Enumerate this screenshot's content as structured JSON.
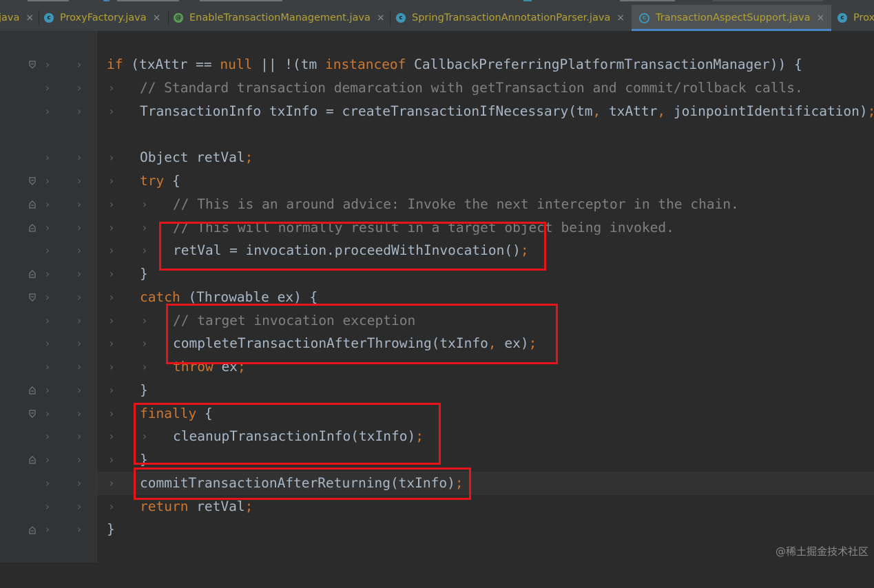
{
  "tabs": [
    {
      "label": "java",
      "icon": "none",
      "active": false
    },
    {
      "label": "ProxyFactory.java",
      "icon": "class-icon",
      "active": false
    },
    {
      "label": "EnableTransactionManagement.java",
      "icon": "annotation-icon",
      "active": false
    },
    {
      "label": "SpringTransactionAnnotationParser.java",
      "icon": "class-icon",
      "active": false
    },
    {
      "label": "TransactionAspectSupport.java",
      "icon": "abstract-class-icon",
      "active": true
    },
    {
      "label": "Prox",
      "icon": "class-icon",
      "active": false
    }
  ],
  "close_glyph": "×",
  "code_lines": [
    "if (txAttr == null || !(tm instanceof CallbackPreferringPlatformTransactionManager)) {",
    "// Standard transaction demarcation with getTransaction and commit/rollback calls.",
    "TransactionInfo txInfo = createTransactionIfNecessary(tm, txAttr, joinpointIdentification);",
    "",
    "Object retVal;",
    "try {",
    "// This is an around advice: Invoke the next interceptor in the chain.",
    "// This will normally result in a target object being invoked.",
    "retVal = invocation.proceedWithInvocation();",
    "}",
    "catch (Throwable ex) {",
    "// target invocation exception",
    "completeTransactionAfterThrowing(txInfo, ex);",
    "throw ex;",
    "}",
    "finally {",
    "cleanupTransactionInfo(txInfo);",
    "}",
    "commitTransactionAfterReturning(txInfo);",
    "return retVal;",
    "}"
  ],
  "watermark": "@稀土掘金技术社区",
  "colors": {
    "background": "#2b2b2b",
    "keyword": "#cc7832",
    "comment": "#808080",
    "text": "#a9b7c6",
    "highlight_box": "#e8141a",
    "tab_active_underline": "#4a88c7"
  }
}
